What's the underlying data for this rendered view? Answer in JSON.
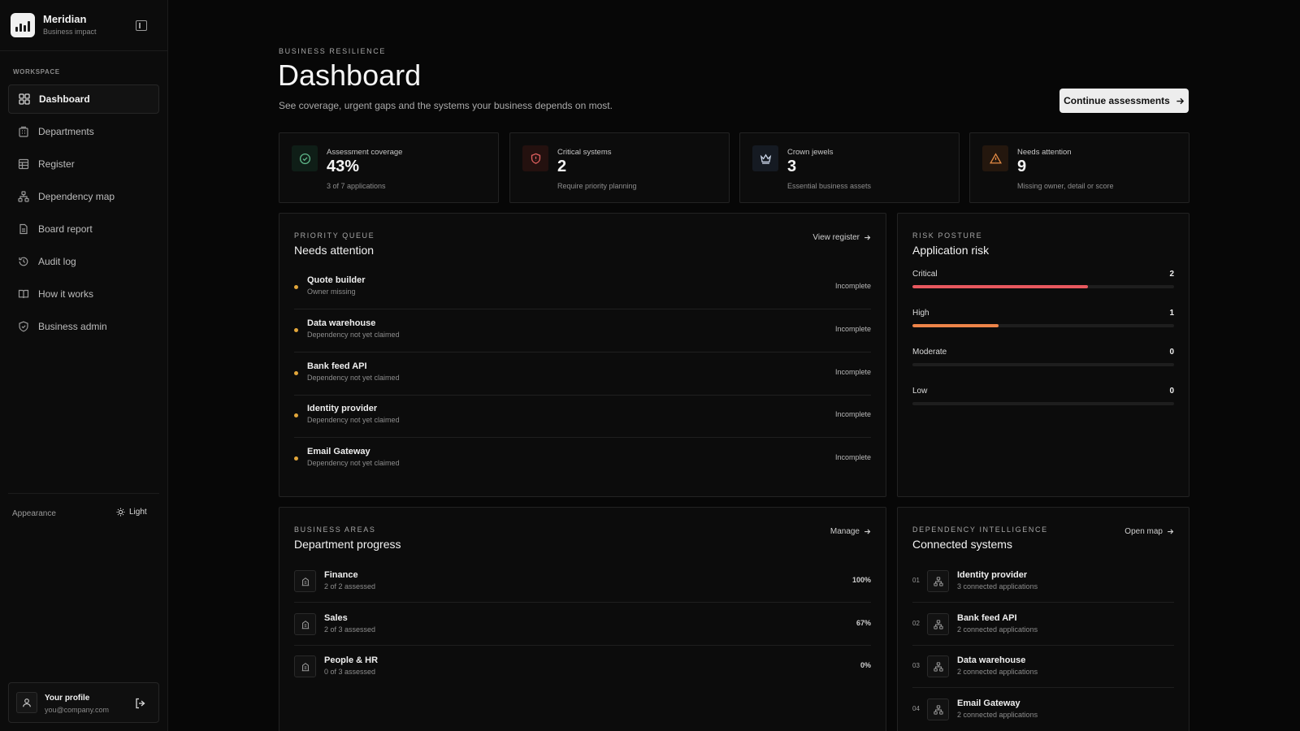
{
  "brand": {
    "name": "Meridian",
    "subtitle": "Business impact"
  },
  "sidebar": {
    "section_label": "WORKSPACE",
    "items": [
      {
        "label": "Dashboard",
        "icon": "grid-icon",
        "active": true
      },
      {
        "label": "Departments",
        "icon": "building-icon"
      },
      {
        "label": "Register",
        "icon": "table-icon"
      },
      {
        "label": "Dependency map",
        "icon": "network-icon"
      },
      {
        "label": "Board report",
        "icon": "file-icon"
      },
      {
        "label": "Audit log",
        "icon": "history-icon"
      },
      {
        "label": "How it works",
        "icon": "book-icon"
      },
      {
        "label": "Business admin",
        "icon": "shield-icon"
      }
    ],
    "appearance_label": "Appearance",
    "theme_label": "Light",
    "profile": {
      "name": "Your profile",
      "email": "you@company.com"
    }
  },
  "header": {
    "eyebrow": "BUSINESS RESILIENCE",
    "title": "Dashboard",
    "subtitle": "See coverage, urgent gaps and the systems your business depends on most.",
    "cta_label": "Continue assessments"
  },
  "stats": [
    {
      "label": "Assessment coverage",
      "value": "43%",
      "desc": "3 of 7 applications",
      "icon": "check-circle-icon",
      "accent": "#5fb88a"
    },
    {
      "label": "Critical systems",
      "value": "2",
      "desc": "Require priority planning",
      "icon": "shield-alert-icon",
      "accent": "#e0605f"
    },
    {
      "label": "Crown jewels",
      "value": "3",
      "desc": "Essential business assets",
      "icon": "crown-icon",
      "accent": "#c9d4e6"
    },
    {
      "label": "Needs attention",
      "value": "9",
      "desc": "Missing owner, detail or score",
      "icon": "warning-icon",
      "accent": "#e28a45"
    }
  ],
  "priority": {
    "eyebrow": "PRIORITY QUEUE",
    "title": "Needs attention",
    "link_label": "View register",
    "items": [
      {
        "name": "Quote builder",
        "detail": "Owner missing",
        "status": "Incomplete"
      },
      {
        "name": "Data warehouse",
        "detail": "Dependency not yet claimed",
        "status": "Incomplete"
      },
      {
        "name": "Bank feed API",
        "detail": "Dependency not yet claimed",
        "status": "Incomplete"
      },
      {
        "name": "Identity provider",
        "detail": "Dependency not yet claimed",
        "status": "Incomplete"
      },
      {
        "name": "Email Gateway",
        "detail": "Dependency not yet claimed",
        "status": "Incomplete"
      }
    ]
  },
  "risk": {
    "eyebrow": "RISK POSTURE",
    "title": "Application risk",
    "levels": [
      {
        "label": "Critical",
        "count": "2",
        "fraction": 0.67,
        "color": "#e8585e"
      },
      {
        "label": "High",
        "count": "1",
        "fraction": 0.33,
        "color": "#ee8449"
      },
      {
        "label": "Moderate",
        "count": "0",
        "fraction": 0,
        "color": "#e2a63a"
      },
      {
        "label": "Low",
        "count": "0",
        "fraction": 0,
        "color": "#5fb88a"
      }
    ]
  },
  "departments": {
    "eyebrow": "BUSINESS AREAS",
    "title": "Department progress",
    "link_label": "Manage",
    "items": [
      {
        "name": "Finance",
        "detail": "2 of 2 assessed",
        "percent": "100%"
      },
      {
        "name": "Sales",
        "detail": "2 of 3 assessed",
        "percent": "67%"
      },
      {
        "name": "People & HR",
        "detail": "0 of 3 assessed",
        "percent": "0%"
      }
    ]
  },
  "dependencies": {
    "eyebrow": "DEPENDENCY INTELLIGENCE",
    "title": "Connected systems",
    "link_label": "Open map",
    "items": [
      {
        "rank": "01",
        "name": "Identity provider",
        "detail": "3 connected applications"
      },
      {
        "rank": "02",
        "name": "Bank feed API",
        "detail": "2 connected applications"
      },
      {
        "rank": "03",
        "name": "Data warehouse",
        "detail": "2 connected applications"
      },
      {
        "rank": "04",
        "name": "Email Gateway",
        "detail": "2 connected applications"
      }
    ]
  }
}
